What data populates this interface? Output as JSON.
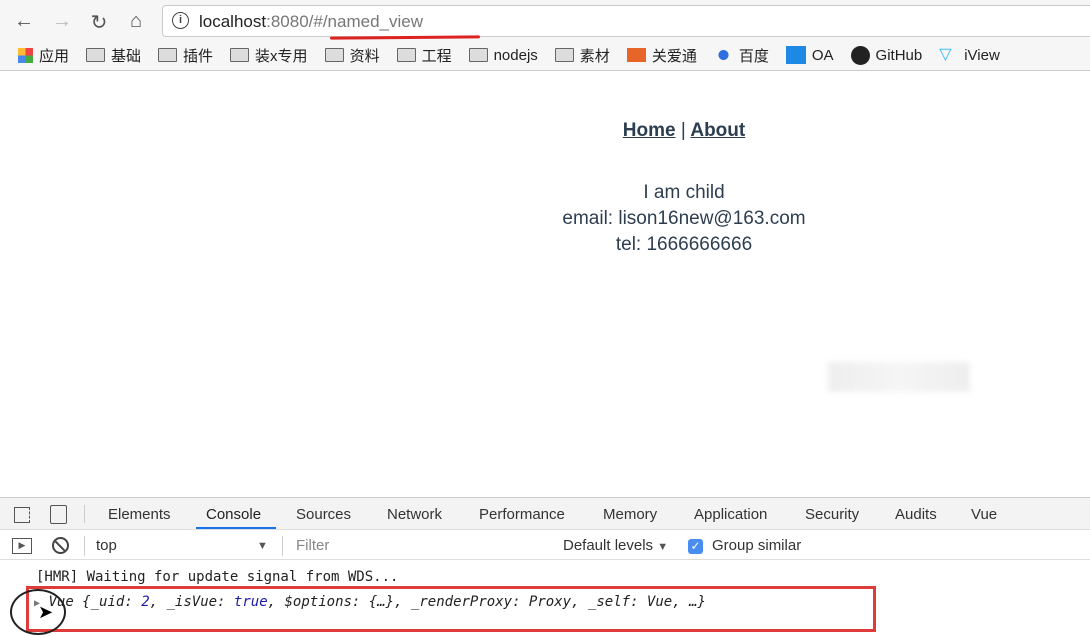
{
  "browser": {
    "url_host": "localhost",
    "url_rest": ":8080/#/named_view",
    "bookmarks": [
      {
        "label": "应用",
        "icon": "apps-grid-icon"
      },
      {
        "label": "基础",
        "icon": "folder-icon"
      },
      {
        "label": "插件",
        "icon": "folder-icon"
      },
      {
        "label": "装x专用",
        "icon": "folder-icon"
      },
      {
        "label": "资料",
        "icon": "folder-icon"
      },
      {
        "label": "工程",
        "icon": "folder-icon"
      },
      {
        "label": "nodejs",
        "icon": "folder-icon"
      },
      {
        "label": "素材",
        "icon": "folder-icon"
      },
      {
        "label": "关爱通",
        "icon": "oai-icon"
      },
      {
        "label": "百度",
        "icon": "baidu-paw-icon"
      },
      {
        "label": "OA",
        "icon": "t-icon"
      },
      {
        "label": "GitHub",
        "icon": "github-icon"
      },
      {
        "label": "iView",
        "icon": "iview-icon"
      }
    ]
  },
  "page": {
    "nav": {
      "home": "Home",
      "separator": "|",
      "about": "About"
    },
    "lines": [
      "I am child",
      "email: lison16new@163.com",
      "tel: 1666666666"
    ]
  },
  "devtools": {
    "tabs": [
      "Elements",
      "Console",
      "Sources",
      "Network",
      "Performance",
      "Memory",
      "Application",
      "Security",
      "Audits",
      "Vue"
    ],
    "active_tab": "Console",
    "context": "top",
    "filter_placeholder": "Filter",
    "levels": "Default levels",
    "group_similar": "Group similar",
    "logs": {
      "hmr": "[HMR] Waiting for update signal from WDS...",
      "vue_prefix": "Vue {_uid: ",
      "vue_uid": "2",
      "vue_mid": ", _isVue: ",
      "vue_true": "true",
      "vue_rest": ", $options: {…}, _renderProxy: Proxy, _self: Vue, …}"
    }
  },
  "colors": {
    "annotation": "#e03b3b",
    "accent": "#1a73e8"
  }
}
